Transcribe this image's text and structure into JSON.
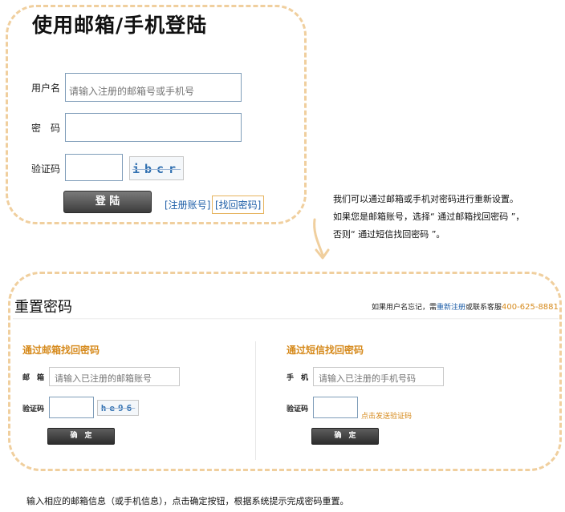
{
  "login": {
    "title": "使用邮箱/手机登陆",
    "username_label": "用户名",
    "username_placeholder": "请输入注册的邮箱号或手机号",
    "password_label": "密　码",
    "captcha_label": "验证码",
    "captcha_text": "ibcr",
    "login_button": "登 陆",
    "register_link": "[注册账号]",
    "forgot_link": "[找回密码]"
  },
  "note_lines": [
    "我们可以通过邮箱或手机对密码进行重新设置。",
    "如果您是邮箱账号，选择“ 通过邮箱找回密码 ”，",
    "否则“ 通过短信找回密码 ”。"
  ],
  "reset": {
    "title": "重置密码",
    "help_prefix": "如果用户名忘记，需",
    "help_link": "重新注册",
    "help_middle": "或联系客服",
    "help_phone": "400-625-8881",
    "email_section": {
      "title": "通过邮箱找回密码",
      "field_label": "邮　箱",
      "field_placeholder": "请输入已注册的邮箱账号",
      "code_label": "验证码",
      "captcha_text": "he96",
      "confirm_button": "确　定"
    },
    "sms_section": {
      "title": "通过短信找回密码",
      "field_label": "手　机",
      "field_placeholder": "请输入已注册的手机号码",
      "code_label": "验证码",
      "send_code_link": "点击发送验证码",
      "confirm_button": "确　定"
    }
  },
  "footer_note": "输入相应的邮箱信息（或手机信息），点击确定按钮，根据系统提示完成密码重置。",
  "colors": {
    "frame_dash": "#f0cf9e",
    "accent_orange": "#d68a1c",
    "link_blue": "#1f5fa8",
    "button_dark": "#3c3c3c"
  }
}
